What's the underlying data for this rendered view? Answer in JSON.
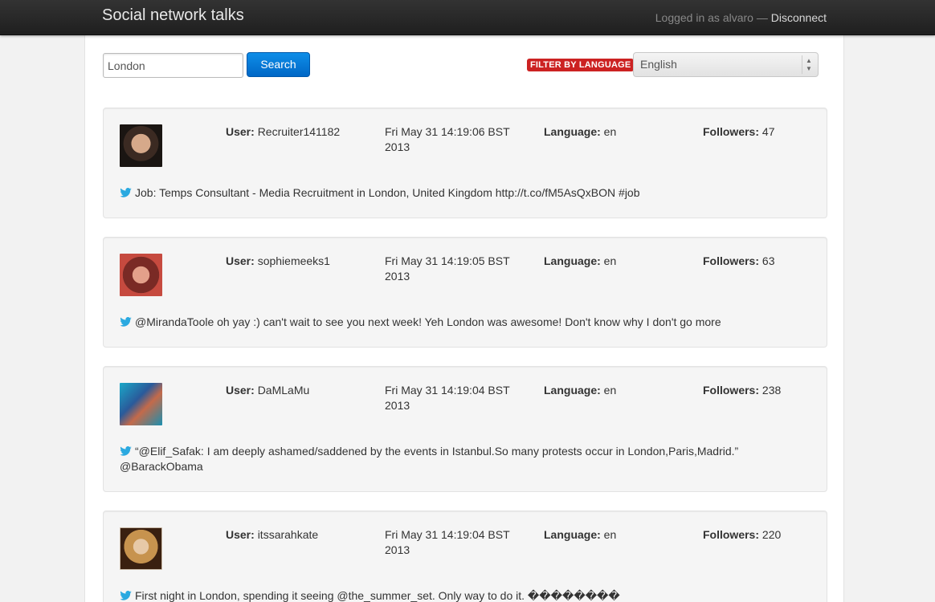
{
  "navbar": {
    "brand": "Social network talks",
    "logged_in_text": "Logged in as alvaro —",
    "disconnect_label": "Disconnect"
  },
  "search": {
    "value": "London",
    "button_label": "Search"
  },
  "filter": {
    "badge_label": "FILTER BY LANGUAGE",
    "selected_language": "English"
  },
  "labels": {
    "user": "User:",
    "language": "Language:",
    "followers": "Followers:"
  },
  "tweets": [
    {
      "user": "Recruiter141182",
      "date": "Fri May 31 14:19:06 BST 2013",
      "language": "en",
      "followers": "47",
      "text": "Job: Temps Consultant - Media Recruitment in London, United Kingdom http://t.co/fM5AsQxBON #job"
    },
    {
      "user": "sophiemeeks1",
      "date": "Fri May 31 14:19:05 BST 2013",
      "language": "en",
      "followers": "63",
      "text": "@MirandaToole oh yay :) can't wait to see you next week! Yeh London was awesome! Don't know why I don't go more"
    },
    {
      "user": "DaMLaMu",
      "date": "Fri May 31 14:19:04 BST 2013",
      "language": "en",
      "followers": "238",
      "text": "“@Elif_Safak: I am deeply ashamed/saddened by the events in Istanbul.So many protests occur in London,Paris,Madrid.” @BarackObama"
    },
    {
      "user": "itssarahkate",
      "date": "Fri May 31 14:19:04 BST 2013",
      "language": "en",
      "followers": "220",
      "text": "First night in London, spending it seeing @the_summer_set. Only way to do it. ��������"
    }
  ],
  "colors": {
    "navbar": "#222222",
    "search_button": "#0074d9",
    "filter_badge": "#cc2222",
    "twitter_bird": "#2aa9e0"
  }
}
